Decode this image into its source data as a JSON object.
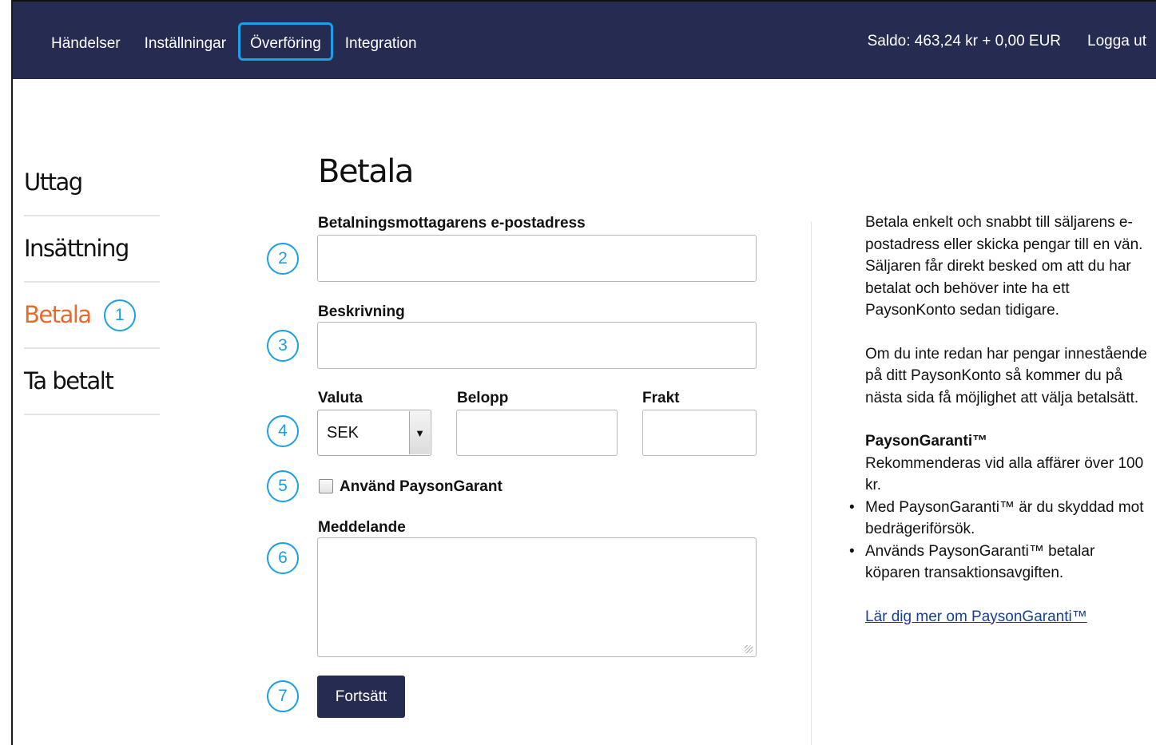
{
  "nav": {
    "items": [
      "Händelser",
      "Inställningar",
      "Överföring",
      "Integration"
    ],
    "balance": "Saldo: 463,24 kr + 0,00 EUR",
    "logout": "Logga ut"
  },
  "sidebar": {
    "items": [
      "Uttag",
      "Insättning",
      "Betala",
      "Ta betalt"
    ]
  },
  "markers": [
    "1",
    "2",
    "3",
    "4",
    "5",
    "6",
    "7"
  ],
  "form": {
    "title": "Betala",
    "email_label": "Betalningsmottagarens e-postadress",
    "email_value": "",
    "description_label": "Beskrivning",
    "description_value": "",
    "currency_label": "Valuta",
    "currency_value": "SEK",
    "amount_label": "Belopp",
    "amount_value": "",
    "shipping_label": "Frakt",
    "shipping_value": "",
    "guarantee_label": "Använd PaysonGarant",
    "message_label": "Meddelande",
    "message_value": "",
    "submit_label": "Fortsätt"
  },
  "info": {
    "para1": "Betala enkelt och snabbt till säljarens e-postadress eller skicka pengar till en vän. Säljaren får direkt besked om att du har betalat och behöver inte ha ett PaysonKonto sedan tidigare.",
    "para2": "Om du inte redan har pengar innestående på ditt PaysonKonto så kommer du på nästa sida få möjlighet att välja betalsätt.",
    "guarantee_title": "PaysonGaranti™",
    "guarantee_text": "Rekommenderas vid alla affärer över 100 kr.",
    "bullets": [
      "Med PaysonGaranti™ är du skyddad mot bedrägeriförsök.",
      "Används PaysonGaranti™ betalar köparen transaktionsavgiften."
    ],
    "link": "Lär dig mer om PaysonGaranti™"
  },
  "colors": {
    "topbar": "#262b51",
    "active": "#e56b2b",
    "marker": "#1a9fe3",
    "link": "#1a3f8f"
  }
}
